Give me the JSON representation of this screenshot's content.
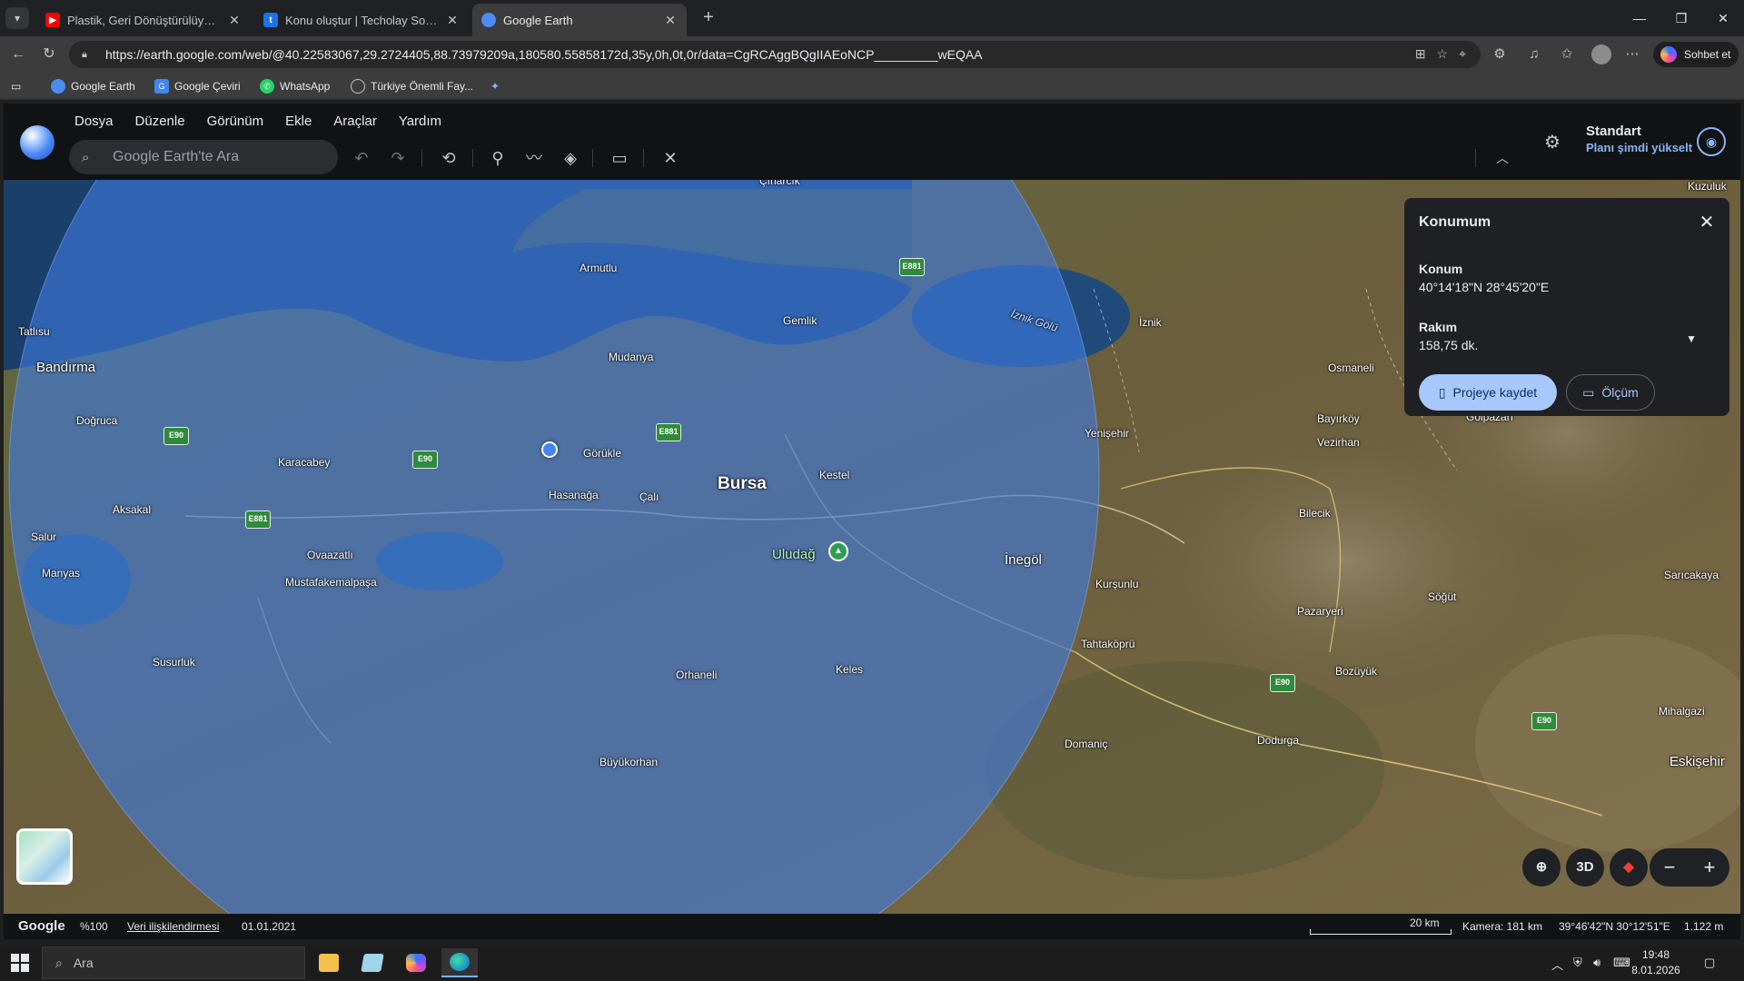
{
  "browser": {
    "tabs": [
      {
        "title": "Plastik, Geri Dönüştürülüyor mu Sa...",
        "icon": "youtube-icon",
        "color": "#ff0000"
      },
      {
        "title": "Konu oluştur | Techolay Sosyal",
        "icon": "techolay-icon",
        "color": "#1a73e8"
      },
      {
        "title": "Google Earth",
        "icon": "google-earth-icon",
        "color": "#4d8cf5"
      }
    ],
    "new_tab": "+",
    "url": "https://earth.google.com/web/@40.22583067,29.2724405,88.73979209a,180580.55858172d,35y,0h,0t,0r/data=CgRCAggBQgIIAEoNCP_________wEQAA",
    "copilot_label": "Sohbet et",
    "bookmarks": [
      {
        "label": "Google Earth",
        "color": "#4d8cf5"
      },
      {
        "label": "Google Çeviri",
        "color": "#4285f4"
      },
      {
        "label": "WhatsApp",
        "color": "#25d366"
      },
      {
        "label": "Türkiye Önemli Fay...",
        "color": "#6f7378"
      }
    ]
  },
  "earth": {
    "menu": [
      "Dosya",
      "Düzenle",
      "Görünüm",
      "Ekle",
      "Araçlar",
      "Yardım"
    ],
    "search_placeholder": "Google Earth'te Ara",
    "plan_title": "Standart",
    "plan_upgrade": "Planı şimdi yükselt",
    "panel": {
      "title": "Konumum",
      "location_label": "Konum",
      "location_value": "40°14'18\"N 28°45'20\"E",
      "elevation_label": "Rakım",
      "elevation_value": "158,75 dk.",
      "save_label": "Projeye kaydet",
      "measure_label": "Ölçüm"
    },
    "map_3d_label": "3D",
    "places": [
      {
        "name": "Çınarcık",
        "cls": ""
      },
      {
        "name": "Armutlu",
        "cls": ""
      },
      {
        "name": "Gemlik",
        "cls": ""
      },
      {
        "name": "İznik Gölü",
        "cls": "water"
      },
      {
        "name": "İznik",
        "cls": ""
      },
      {
        "name": "Tatlısu",
        "cls": ""
      },
      {
        "name": "Bandırma",
        "cls": "mid"
      },
      {
        "name": "Mudanya",
        "cls": ""
      },
      {
        "name": "Osmaneli",
        "cls": ""
      },
      {
        "name": "Doğruca",
        "cls": ""
      },
      {
        "name": "Yenişehir",
        "cls": ""
      },
      {
        "name": "Bayırköy",
        "cls": ""
      },
      {
        "name": "Gölpazarı",
        "cls": ""
      },
      {
        "name": "Vezirhan",
        "cls": ""
      },
      {
        "name": "Karacabey",
        "cls": ""
      },
      {
        "name": "Görükle",
        "cls": ""
      },
      {
        "name": "Bursa",
        "cls": "big"
      },
      {
        "name": "Kestel",
        "cls": ""
      },
      {
        "name": "Hasanağa",
        "cls": ""
      },
      {
        "name": "Çalı",
        "cls": ""
      },
      {
        "name": "Aksakal",
        "cls": ""
      },
      {
        "name": "Bilecik",
        "cls": ""
      },
      {
        "name": "Salur",
        "cls": ""
      },
      {
        "name": "Uludağ",
        "cls": "mid"
      },
      {
        "name": "İnegöl",
        "cls": "mid"
      },
      {
        "name": "Ovaazatlı",
        "cls": ""
      },
      {
        "name": "Manyas",
        "cls": ""
      },
      {
        "name": "Mustafakemalpaşa",
        "cls": ""
      },
      {
        "name": "Kurşunlu",
        "cls": ""
      },
      {
        "name": "Sarıcakaya",
        "cls": ""
      },
      {
        "name": "Söğüt",
        "cls": ""
      },
      {
        "name": "Pazaryeri",
        "cls": ""
      },
      {
        "name": "Tahtaköprü",
        "cls": ""
      },
      {
        "name": "Susurluk",
        "cls": ""
      },
      {
        "name": "Bozüyük",
        "cls": ""
      },
      {
        "name": "Orhaneli",
        "cls": ""
      },
      {
        "name": "Keles",
        "cls": ""
      },
      {
        "name": "Mihalgazi",
        "cls": ""
      },
      {
        "name": "Domaniç",
        "cls": ""
      },
      {
        "name": "Dodurga",
        "cls": ""
      },
      {
        "name": "Büyükorhan",
        "cls": ""
      },
      {
        "name": "Eskişehir",
        "cls": "mid"
      },
      {
        "name": "Kuzuluk",
        "cls": ""
      }
    ],
    "shields": [
      "E881",
      "E90",
      "E881",
      "E90",
      "E881",
      "E90",
      "E90"
    ],
    "status": {
      "logo": "Google",
      "zoom": "%100",
      "attribution": "Veri ilişkilendirmesi",
      "date": "01.01.2021",
      "scale": "20 km",
      "camera": "Kamera: 181 km",
      "coords": "39°46'42\"N 30°12'51\"E",
      "elevation": "1.122 m"
    }
  },
  "taskbar": {
    "search_label": "Ara",
    "time": "19:48",
    "date": "8.01.2026"
  }
}
